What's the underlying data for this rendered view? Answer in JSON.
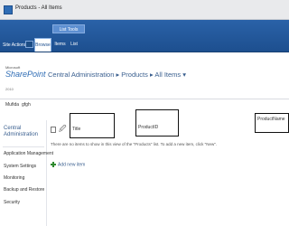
{
  "window": {
    "title": "Products - All Items"
  },
  "ribbon": {
    "context_group": "List Tools",
    "site_actions": "Site Actions ▾",
    "tabs": [
      {
        "label": "Browse"
      },
      {
        "label": "Items"
      },
      {
        "label": "List"
      }
    ]
  },
  "logo": {
    "vendor": "Microsoft",
    "product": "SharePoint",
    "year": "2010"
  },
  "breadcrumb": {
    "text": "Central Administration ▸ Products ▸ All Items ▾"
  },
  "userbar": {
    "user": "Mufida",
    "link": "gfgh"
  },
  "quick_launch": {
    "items": [
      {
        "label": "Central Administration"
      },
      {
        "label": "Application Management"
      },
      {
        "label": "System Settings"
      },
      {
        "label": "Monitoring"
      },
      {
        "label": "Backup and Restore"
      },
      {
        "label": "Security"
      }
    ]
  },
  "list": {
    "columns": [
      {
        "label": "Title"
      },
      {
        "label": "ProductID"
      },
      {
        "label": "ProductName"
      }
    ],
    "empty_message": "There are no items to show in this view of the \"Products\" list. To add a new item, click \"New\".",
    "add_new_item": "Add new item"
  },
  "colors": {
    "ribbon": "#1d4f8f",
    "accent": "#2f6db5",
    "link": "#3a5f8f"
  }
}
